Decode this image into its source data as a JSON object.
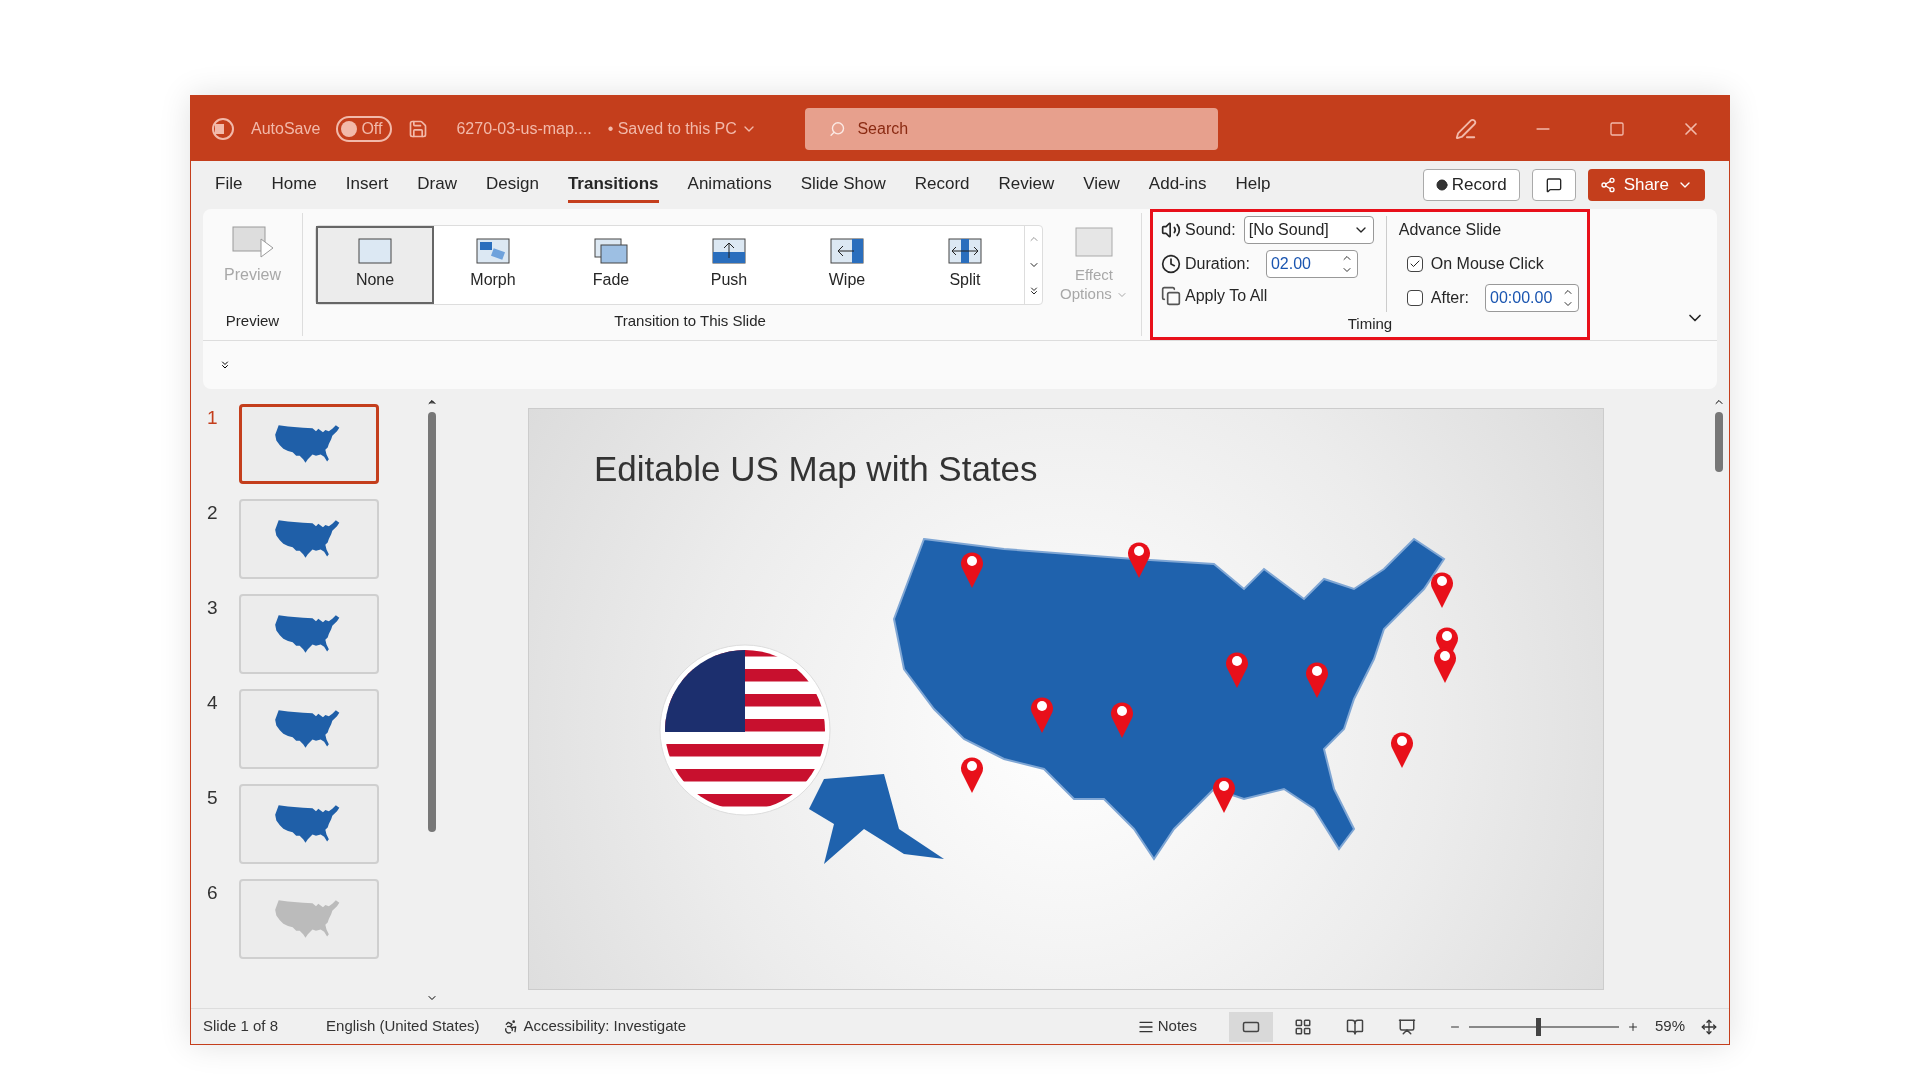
{
  "titlebar": {
    "autosave_label": "AutoSave",
    "autosave_toggle": {
      "label": "Off",
      "on": false
    },
    "filename": "6270-03-us-map....",
    "save_status": "• Saved to this PC",
    "search": {
      "placeholder": "Search"
    }
  },
  "menu_tabs": [
    {
      "label": "File",
      "selected": false
    },
    {
      "label": "Home",
      "selected": false
    },
    {
      "label": "Insert",
      "selected": false
    },
    {
      "label": "Draw",
      "selected": false
    },
    {
      "label": "Design",
      "selected": false
    },
    {
      "label": "Transitions",
      "selected": true
    },
    {
      "label": "Animations",
      "selected": false
    },
    {
      "label": "Slide Show",
      "selected": false
    },
    {
      "label": "Record",
      "selected": false
    },
    {
      "label": "Review",
      "selected": false
    },
    {
      "label": "View",
      "selected": false
    },
    {
      "label": "Add-ins",
      "selected": false
    },
    {
      "label": "Help",
      "selected": false
    }
  ],
  "record_button": "Record",
  "share_button": "Share",
  "ribbon": {
    "preview_group": {
      "button": "Preview",
      "disabled": true,
      "label": "Preview"
    },
    "transitions": {
      "items": [
        {
          "label": "None",
          "kind": "none",
          "selected": true
        },
        {
          "label": "Morph",
          "kind": "morph",
          "selected": false
        },
        {
          "label": "Fade",
          "kind": "fade",
          "selected": false
        },
        {
          "label": "Push",
          "kind": "push",
          "selected": false
        },
        {
          "label": "Wipe",
          "kind": "wipe",
          "selected": false
        },
        {
          "label": "Split",
          "kind": "split",
          "selected": false
        }
      ],
      "label": "Transition to This Slide"
    },
    "effect_options": {
      "label": "Effect Options",
      "disabled": true
    },
    "timing": {
      "sound_label": "Sound:",
      "sound_value": "[No Sound]",
      "duration_label": "Duration:",
      "duration_value": "02.00",
      "apply_all": "Apply To All",
      "advance_title": "Advance Slide",
      "on_mouse_click": {
        "label": "On Mouse Click",
        "checked": true
      },
      "after": {
        "label": "After:",
        "checked": false,
        "value": "00:00.00"
      },
      "label": "Timing"
    }
  },
  "thumbnails": [
    {
      "number": "1",
      "selected": true
    },
    {
      "number": "2",
      "selected": false
    },
    {
      "number": "3",
      "selected": false
    },
    {
      "number": "4",
      "selected": false
    },
    {
      "number": "5",
      "selected": false
    },
    {
      "number": "6",
      "selected": false
    }
  ],
  "slide": {
    "title": "Editable US Map with States"
  },
  "status_bar": {
    "slide": "Slide 1 of 8",
    "language": "English (United States)",
    "accessibility": "Accessibility: Investigate",
    "notes": "Notes",
    "views": [
      {
        "kind": "normal",
        "selected": true
      },
      {
        "kind": "sorter",
        "selected": false
      },
      {
        "kind": "reading",
        "selected": false
      },
      {
        "kind": "presenter",
        "selected": false
      }
    ],
    "zoom": {
      "level": 0.45,
      "reading": "59%"
    }
  }
}
